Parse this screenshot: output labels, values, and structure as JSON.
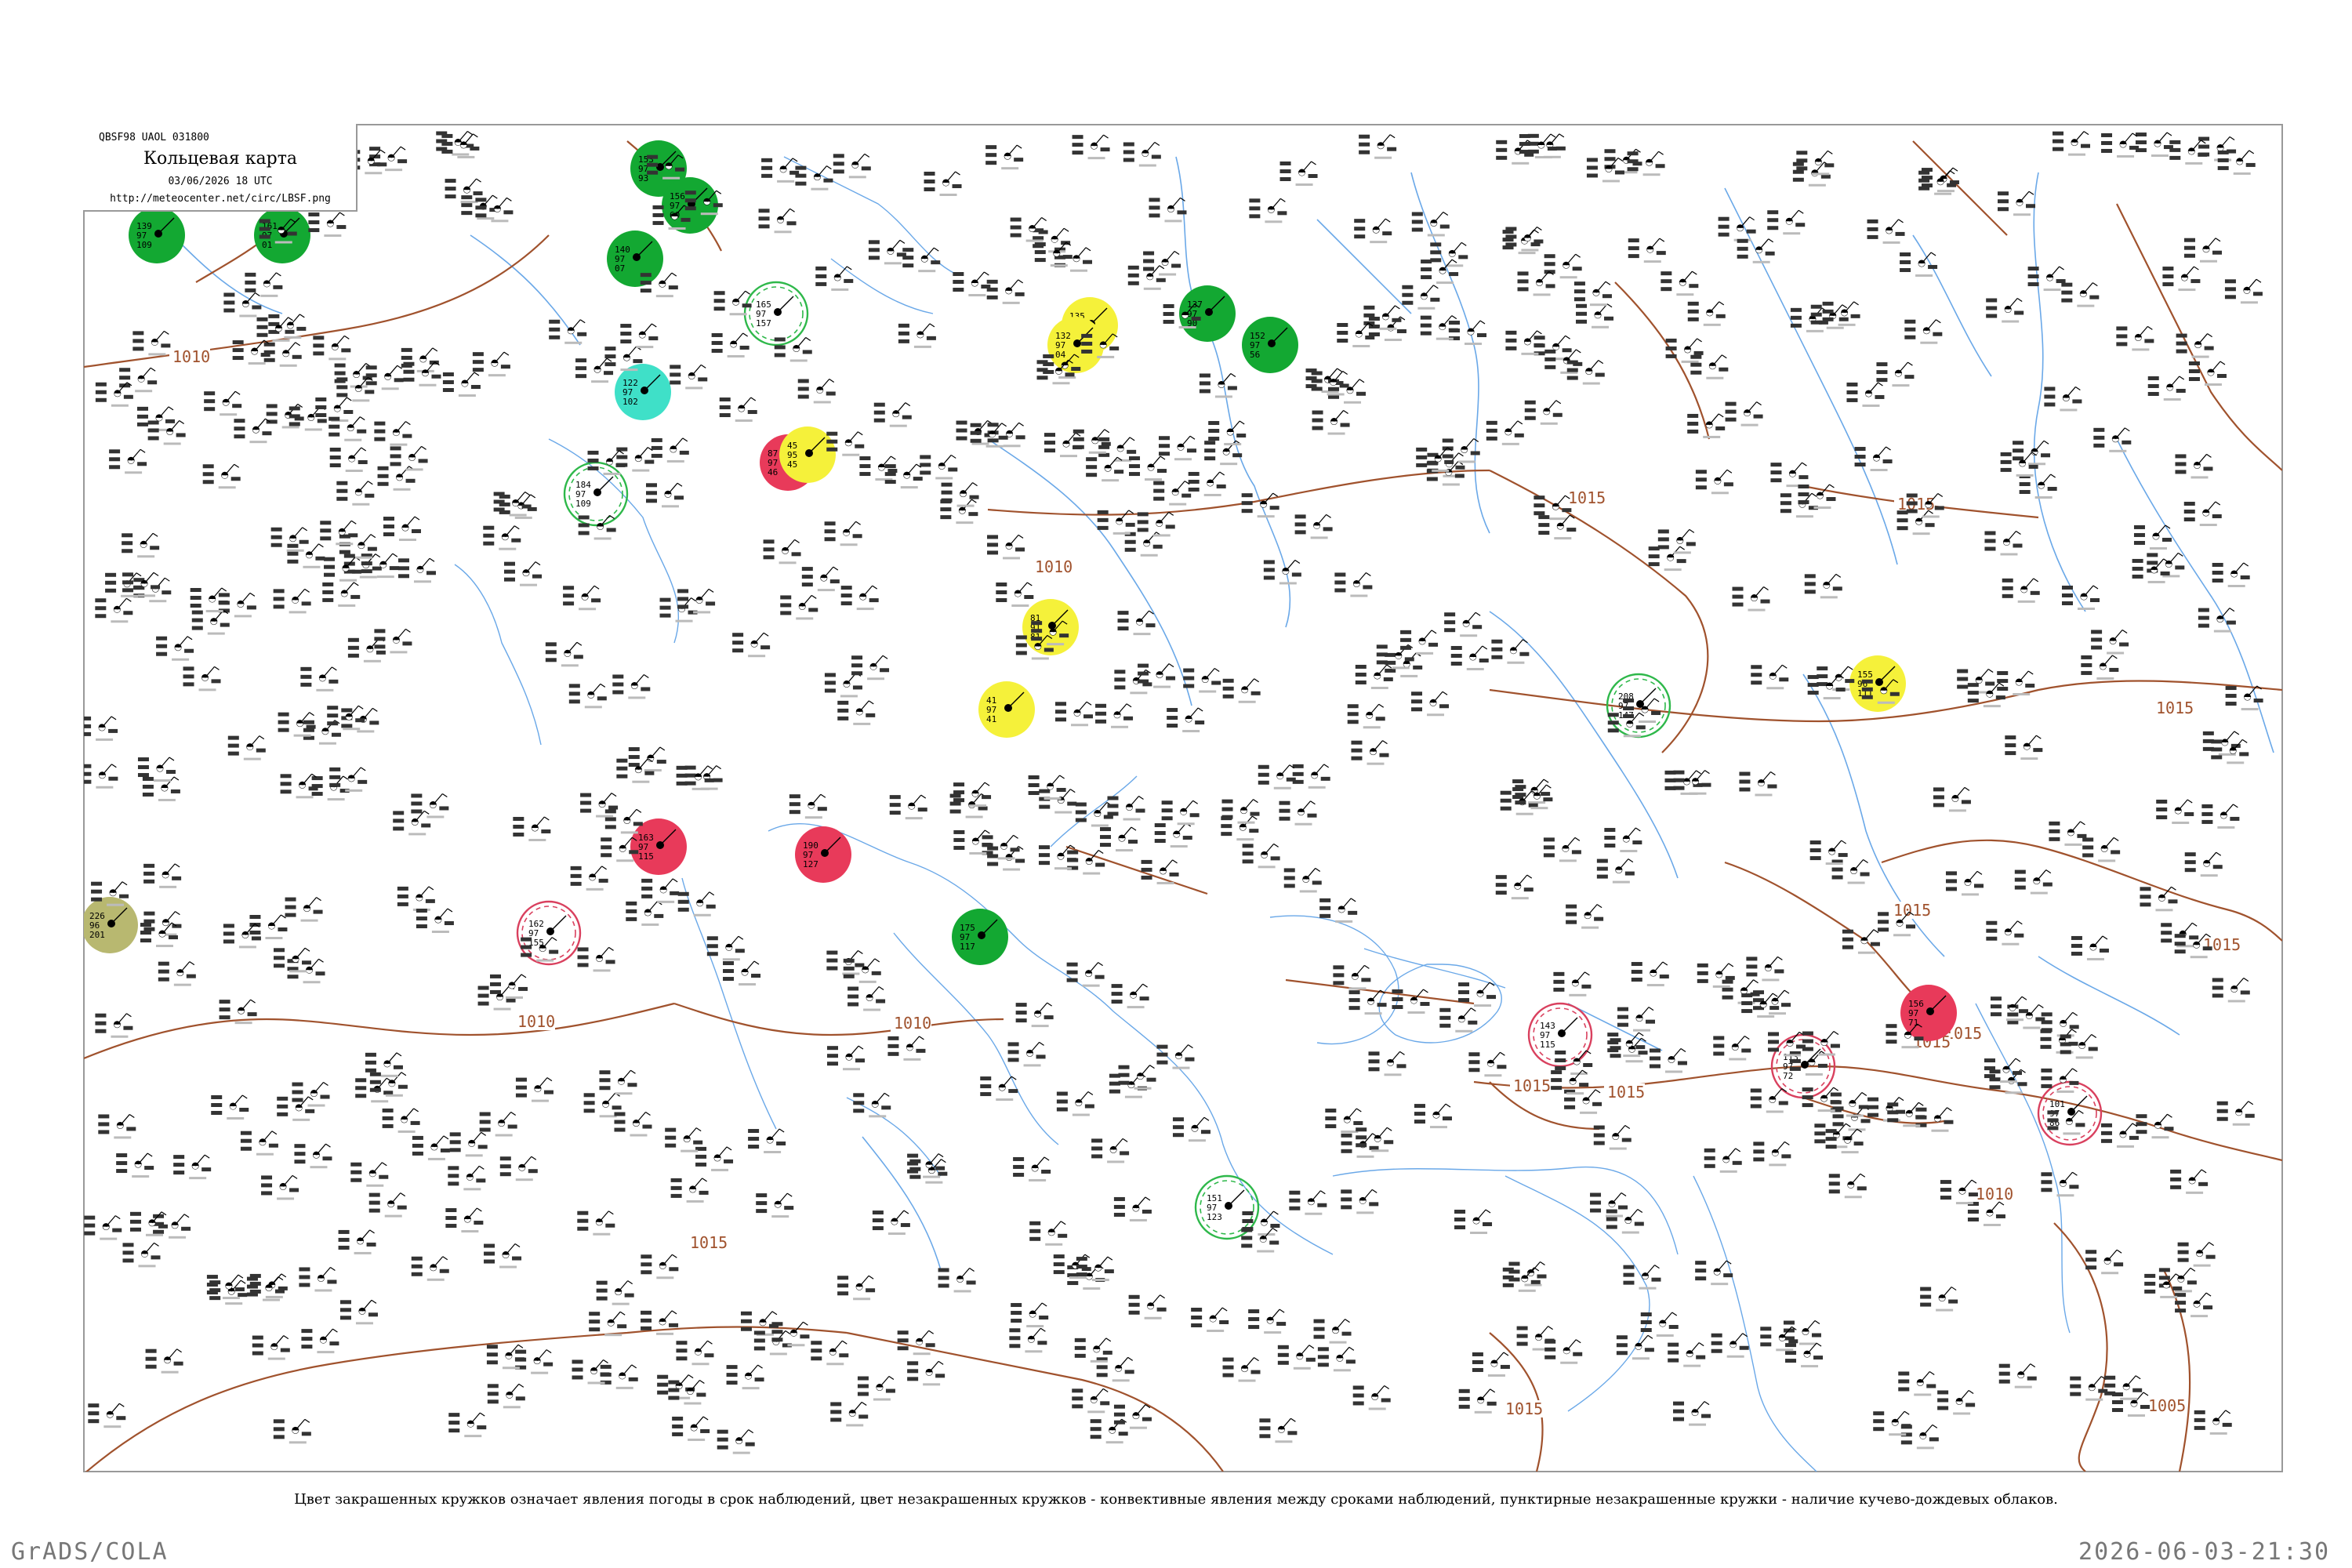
{
  "title_box": {
    "code": "QBSF98  UAOL  031800",
    "title": "Кольцевая карта",
    "date": "03/06/2026 18 UTC",
    "url": "http://meteocenter.net/circ/LBSF.png"
  },
  "caption": "Цвет закрашенных кружков означает явления погоды в срок наблюдений, цвет незакрашенных кружков - конвективные явления между сроками наблюдений, пунктирные незакрашенные кружки - наличие кучево-дождевых облаков.",
  "footer": {
    "left": "GrADS/COLA",
    "right": "2026-06-03-21:30"
  },
  "colors": {
    "isobar": "#a0522d",
    "water": "#6aa8e8",
    "filled_rain": "#13a832",
    "filled_thunder": "#e83a5a",
    "filled_fog": "#f5f13a",
    "filled_drizzle": "#3fe0c8",
    "filled_haze": "#b8b870",
    "ring_convective_green": "#2eb84a",
    "ring_convective_red": "#d9405e"
  },
  "isobar_labels": [
    {
      "text": "1010",
      "id": "w"
    },
    {
      "text": "1015",
      "id": "center"
    },
    {
      "text": "1015",
      "id": "ne"
    },
    {
      "text": "1015",
      "id": "east"
    },
    {
      "text": "1010",
      "id": "sw"
    },
    {
      "text": "1010",
      "id": "s"
    },
    {
      "text": "1015",
      "id": "south"
    },
    {
      "text": "1015",
      "id": "se1"
    },
    {
      "text": "1015",
      "id": "se2"
    },
    {
      "text": "1010",
      "id": "se3"
    },
    {
      "text": "1005",
      "id": "se4"
    },
    {
      "text": "1015",
      "id": "bottom"
    },
    {
      "text": "1010",
      "id": "mid"
    },
    {
      "text": "1015",
      "id": "far-east"
    },
    {
      "text": "1015",
      "id": "east2"
    },
    {
      "text": "1015",
      "id": "caucasus"
    },
    {
      "text": "1015",
      "id": "kaz"
    }
  ],
  "legend_classes": [
    "filled_rain",
    "filled_thunder",
    "filled_fog",
    "filled_drizzle",
    "filled_haze",
    "ring_convective_green",
    "ring_convective_red"
  ],
  "stations": [
    {
      "t": "139",
      "p": "97",
      "d": "109",
      "cls": "filled_rain",
      "ring": false
    },
    {
      "t": "161",
      "p": "97",
      "d": "01",
      "cls": "filled_rain",
      "ring": false
    },
    {
      "t": "153",
      "p": "97",
      "d": "93",
      "cls": "filled_rain",
      "ring": false
    },
    {
      "t": "156",
      "p": "97",
      "d": "60",
      "cls": "filled_rain",
      "ring": false
    },
    {
      "t": "140",
      "p": "97",
      "d": "07",
      "cls": "filled_rain",
      "ring": false
    },
    {
      "t": "87",
      "p": "97",
      "d": "46",
      "cls": "filled_thunder",
      "ring": false
    },
    {
      "t": "135",
      "p": "96",
      "d": "122",
      "cls": "filled_fog",
      "ring": false
    },
    {
      "t": "132",
      "p": "97",
      "d": "04",
      "cls": "filled_fog",
      "ring": false
    },
    {
      "t": "81",
      "p": "91",
      "d": "81",
      "cls": "filled_fog",
      "ring": false
    },
    {
      "t": "41",
      "p": "97",
      "d": "41",
      "cls": "filled_fog",
      "ring": false
    },
    {
      "t": "155",
      "p": "96",
      "d": "111",
      "cls": "filled_fog",
      "ring": false
    },
    {
      "t": "45",
      "p": "95",
      "d": "45",
      "cls": "filled_fog",
      "ring": false
    },
    {
      "t": "122",
      "p": "97",
      "d": "102",
      "cls": "filled_drizzle",
      "ring": false
    },
    {
      "t": "226",
      "p": "96",
      "d": "201",
      "cls": "filled_haze",
      "ring": false
    },
    {
      "t": "137",
      "p": "97",
      "d": "90",
      "cls": "filled_rain",
      "ring": false
    },
    {
      "t": "152",
      "p": "97",
      "d": "56",
      "cls": "filled_rain",
      "ring": false
    },
    {
      "t": "156",
      "p": "97",
      "d": "71",
      "cls": "filled_thunder",
      "ring": false
    },
    {
      "t": "163",
      "p": "97",
      "d": "115",
      "cls": "filled_thunder",
      "ring": false
    },
    {
      "t": "190",
      "p": "97",
      "d": "127",
      "cls": "filled_thunder",
      "ring": false
    },
    {
      "t": "175",
      "p": "97",
      "d": "117",
      "cls": "filled_rain",
      "ring": false
    },
    {
      "t": "165",
      "p": "97",
      "d": "157",
      "cls": "ring_convective_green",
      "ring": true
    },
    {
      "t": "151",
      "p": "97",
      "d": "123",
      "cls": "ring_convective_green",
      "ring": true
    },
    {
      "t": "143",
      "p": "97",
      "d": "115",
      "cls": "ring_convective_red",
      "ring": true
    },
    {
      "t": "184",
      "p": "97",
      "d": "109",
      "cls": "ring_convective_green",
      "ring": true
    },
    {
      "t": "162",
      "p": "97",
      "d": "155",
      "cls": "ring_convective_red",
      "ring": true
    },
    {
      "t": "208",
      "p": "97",
      "d": "147",
      "cls": "ring_convective_green",
      "ring": true
    },
    {
      "t": "113",
      "p": "97",
      "d": "72",
      "cls": "ring_convective_red",
      "ring": true
    },
    {
      "t": "101",
      "p": "97",
      "d": "86",
      "cls": "ring_convective_red",
      "ring": true
    }
  ]
}
